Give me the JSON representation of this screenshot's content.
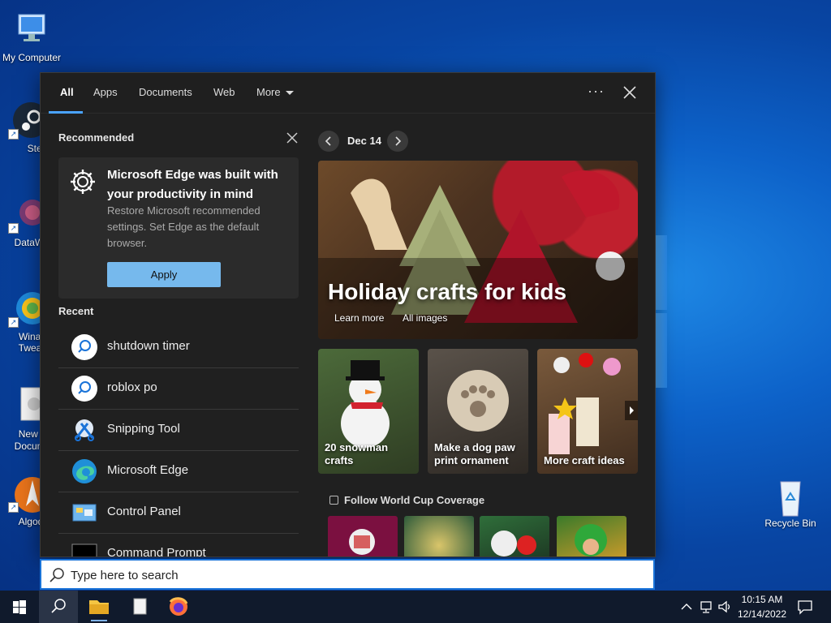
{
  "desktop": {
    "icons": [
      {
        "label": "My Computer"
      },
      {
        "label": "Stea"
      },
      {
        "label": "DataWa"
      },
      {
        "label": "Winae\nTweak"
      },
      {
        "label": "New T\nDocume"
      },
      {
        "label": "Algod"
      },
      {
        "label": "Recycle Bin"
      }
    ]
  },
  "search_panel": {
    "tabs": [
      {
        "label": "All",
        "active": true
      },
      {
        "label": "Apps"
      },
      {
        "label": "Documents"
      },
      {
        "label": "Web"
      },
      {
        "label": "More"
      }
    ],
    "more_options": "···",
    "recommended": {
      "heading": "Recommended",
      "card_title": "Microsoft Edge was built with your productivity in mind",
      "card_desc": "Restore Microsoft recommended settings. Set Edge as the default browser.",
      "apply_label": "Apply"
    },
    "recent": {
      "heading": "Recent",
      "items": [
        {
          "label": "shutdown timer",
          "icon": "search-icon"
        },
        {
          "label": "roblox po",
          "icon": "search-icon"
        },
        {
          "label": "Snipping Tool",
          "icon": "snipping-tool-icon"
        },
        {
          "label": "Microsoft Edge",
          "icon": "edge-icon"
        },
        {
          "label": "Control Panel",
          "icon": "control-panel-icon"
        },
        {
          "label": "Command Prompt",
          "icon": "command-prompt-icon"
        }
      ]
    },
    "highlights": {
      "date": "Dec 14",
      "hero_title": "Holiday crafts for kids",
      "hero_links": [
        "Learn more",
        "All images"
      ],
      "tiles": [
        {
          "caption": "20 snowman\ncrafts"
        },
        {
          "caption": "Make a dog paw\nprint ornament"
        },
        {
          "caption": "More craft ideas"
        }
      ],
      "world_cup_title": "Follow World Cup Coverage"
    }
  },
  "search_box": {
    "placeholder": "Type here to search"
  },
  "taskbar": {
    "time": "10:15 AM",
    "date": "12/14/2022"
  },
  "colors": {
    "accent": "#4aa3ff",
    "apply_button": "#76b9ed",
    "panel_bg": "#202020"
  }
}
